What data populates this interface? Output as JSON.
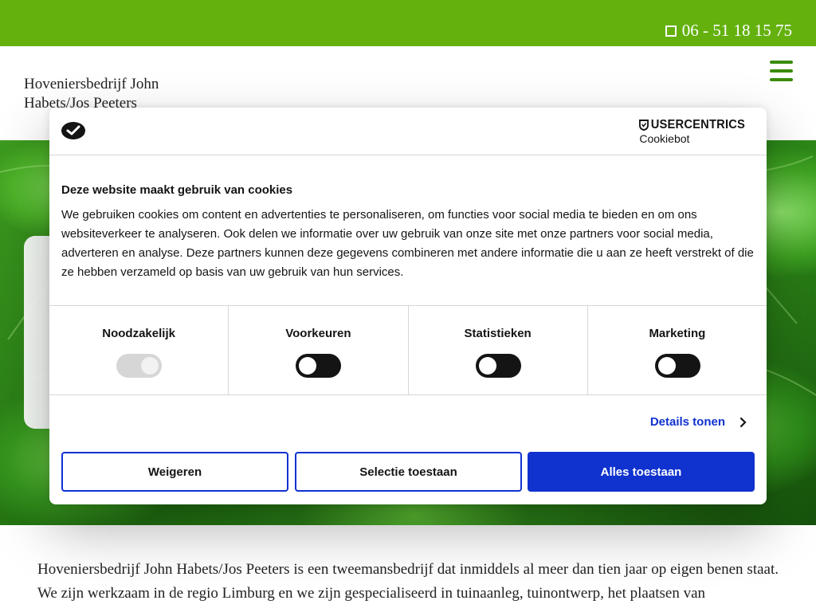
{
  "topbar": {
    "phone": "06 - 51 18 15 75",
    "phone_icon": "phone-icon",
    "color": "#64b10e"
  },
  "header": {
    "logo_line1": "Hoveniersbedrijf John",
    "logo_line2": "Habets/Jos Peeters",
    "menu_icon": "hamburger-icon"
  },
  "intro": {
    "text": "Hoveniersbedrijf John Habets/Jos Peeters is een tweemansbedrijf dat inmiddels al meer dan tien jaar op eigen benen staat. We zijn werkzaam in de regio Limburg en we zijn gespecialiseerd in tuinaanleg, tuinontwerp, het plaatsen van"
  },
  "cookie_dialog": {
    "brand_name": "USERCENTRICS",
    "brand_sub": "Cookiebot",
    "title": "Deze website maakt gebruik van cookies",
    "body": "We gebruiken cookies om content en advertenties te personaliseren, om functies voor social media te bieden en om ons websiteverkeer te analyseren. Ook delen we informatie over uw gebruik van onze site met onze partners voor social media, adverteren en analyse. Deze partners kunnen deze gegevens combineren met andere informatie die u aan ze heeft verstrekt of die ze hebben verzameld op basis van uw gebruik van hun services.",
    "categories": [
      {
        "label": "Noodzakelijk",
        "enabled": true,
        "locked": true
      },
      {
        "label": "Voorkeuren",
        "enabled": false,
        "locked": false
      },
      {
        "label": "Statistieken",
        "enabled": false,
        "locked": false
      },
      {
        "label": "Marketing",
        "enabled": false,
        "locked": false
      }
    ],
    "details_label": "Details tonen",
    "buttons": {
      "reject": "Weigeren",
      "allow_selection": "Selectie toestaan",
      "allow_all": "Alles toestaan"
    },
    "accent_color": "#1032cf"
  }
}
